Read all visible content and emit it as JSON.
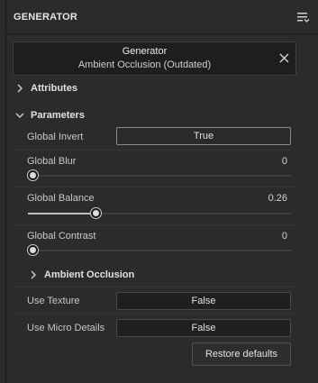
{
  "panel": {
    "title": "GENERATOR",
    "menu_icon": "filter-menu-icon"
  },
  "generator": {
    "title": "Generator",
    "subtitle": "Ambient Occlusion (Outdated)",
    "close_icon": "close-icon"
  },
  "sections": {
    "attributes": {
      "label": "Attributes",
      "expanded": false
    },
    "parameters": {
      "label": "Parameters",
      "expanded": true
    },
    "ambient_occlusion": {
      "label": "Ambient Occlusion",
      "expanded": false
    }
  },
  "parameters": {
    "global_invert": {
      "label": "Global Invert",
      "value": "True"
    },
    "global_blur": {
      "label": "Global Blur",
      "value": "0",
      "fraction": 0.0
    },
    "global_balance": {
      "label": "Global Balance",
      "value": "0.26",
      "fraction": 0.26
    },
    "global_contrast": {
      "label": "Global Contrast",
      "value": "0",
      "fraction": 0.0
    }
  },
  "ambient_occlusion": {
    "use_texture": {
      "label": "Use Texture",
      "value": "False"
    },
    "use_micro_details": {
      "label": "Use Micro Details",
      "value": "False"
    }
  },
  "actions": {
    "restore_label": "Restore defaults"
  },
  "colors": {
    "panel_bg": "#2b2b2b",
    "field_bg": "#1f1f1f",
    "text": "#d6d6d6",
    "slider_fill": "#bdbdbd"
  }
}
